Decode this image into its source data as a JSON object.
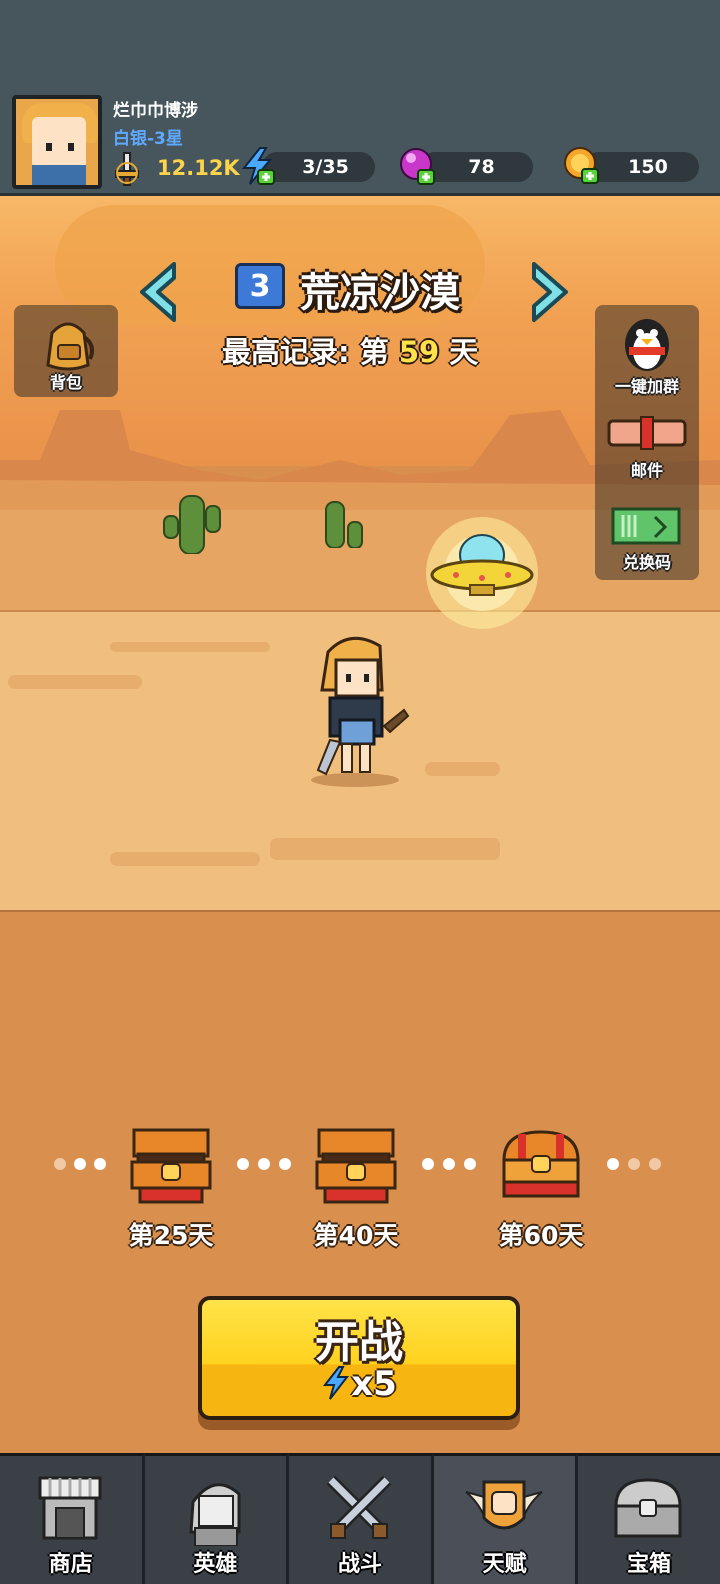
{
  "player": {
    "name": "烂巾巾博涉",
    "rank": "白银-3星",
    "power": "12.12K"
  },
  "resources": {
    "energy": "3/35",
    "gems": "78",
    "gold": "150"
  },
  "level": {
    "number": "3",
    "name": "荒凉沙漠",
    "record_prefix": "最高记录: 第",
    "record_days": "59",
    "record_suffix": "天"
  },
  "side_buttons": {
    "bag": "背包",
    "join_group": "一键加群",
    "mail": "邮件",
    "redeem": "兑换码"
  },
  "chests": [
    {
      "label": "第25天"
    },
    {
      "label": "第40天"
    },
    {
      "label": "第60天"
    }
  ],
  "start_button": {
    "label": "开战",
    "cost": "x5"
  },
  "nav": [
    {
      "label": "商店",
      "icon": "shop-icon"
    },
    {
      "label": "英雄",
      "icon": "hero-icon"
    },
    {
      "label": "战斗",
      "icon": "battle-swords-icon"
    },
    {
      "label": "天赋",
      "icon": "talent-fist-icon"
    },
    {
      "label": "宝箱",
      "icon": "chest-icon"
    }
  ],
  "colors": {
    "topbar": "#46565c",
    "record_highlight": "#ffe14a",
    "level_badge": "#3d7ad8",
    "start_button": "#ffd21f",
    "rank": "#5fa8ff"
  }
}
